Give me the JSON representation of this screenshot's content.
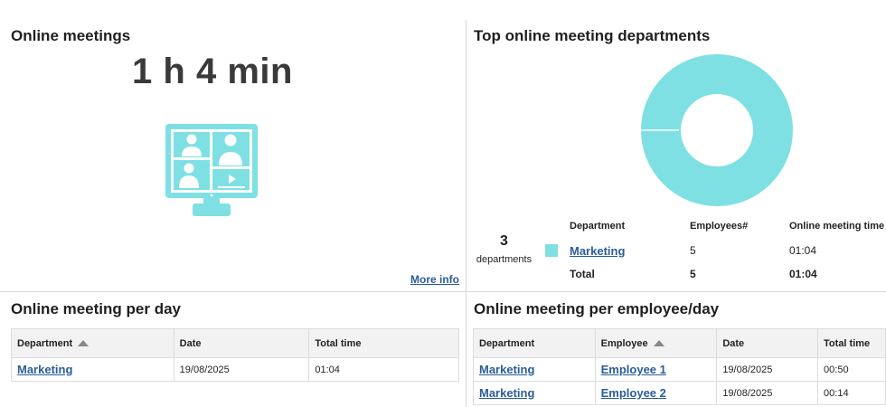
{
  "online_meetings": {
    "title": "Online meetings",
    "total_time": "1 h 4 min",
    "more_info": "More info"
  },
  "top_departments": {
    "title": "Top online meeting departments",
    "count": "3",
    "count_label": "departments",
    "headers": [
      "Department",
      "Employees#",
      "Online meeting time"
    ],
    "rows": [
      {
        "department": "Marketing",
        "employees": "5",
        "time": "01:04"
      }
    ],
    "total": {
      "label": "Total",
      "employees": "5",
      "time": "01:04"
    },
    "colors": {
      "marketing": "#7ee0e3"
    }
  },
  "per_day": {
    "title": "Online meeting per day",
    "headers": [
      "Department",
      "Date",
      "Total time"
    ],
    "rows": [
      {
        "department": "Marketing",
        "date": "19/08/2025",
        "total_time": "01:04"
      }
    ]
  },
  "per_employee_day": {
    "title": "Online meeting per employee/day",
    "headers": [
      "Department",
      "Employee",
      "Date",
      "Total time"
    ],
    "rows": [
      {
        "department": "Marketing",
        "employee": "Employee 1",
        "date": "19/08/2025",
        "total_time": "00:50"
      },
      {
        "department": "Marketing",
        "employee": "Employee 2",
        "date": "19/08/2025",
        "total_time": "00:14"
      }
    ]
  },
  "icons": {
    "monitor": "video-conference-monitor-icon",
    "sort": "sort-ascending-icon"
  }
}
